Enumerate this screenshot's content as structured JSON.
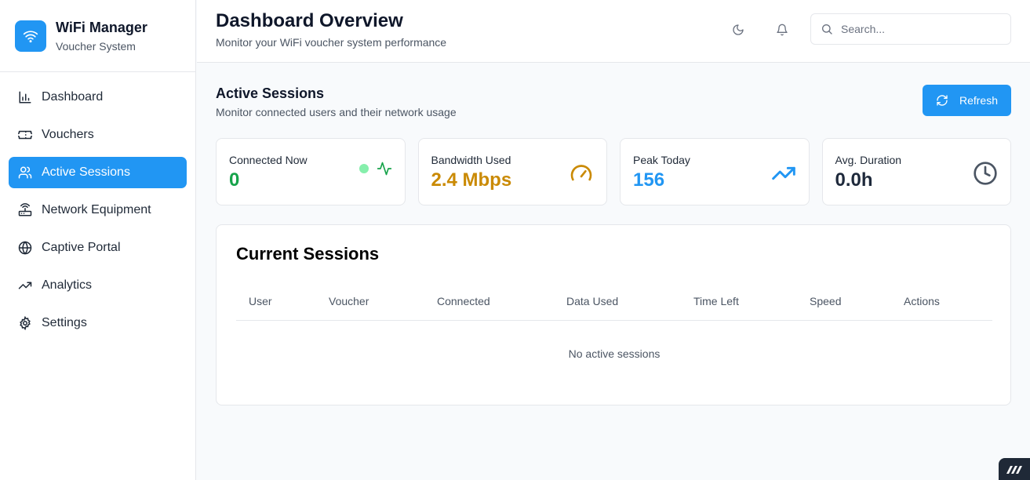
{
  "brand": {
    "title": "WiFi Manager",
    "subtitle": "Voucher System"
  },
  "sidebar": {
    "items": [
      {
        "label": "Dashboard",
        "icon": "bar-chart-icon",
        "active": false
      },
      {
        "label": "Vouchers",
        "icon": "ticket-icon",
        "active": false
      },
      {
        "label": "Active Sessions",
        "icon": "users-icon",
        "active": true
      },
      {
        "label": "Network Equipment",
        "icon": "router-icon",
        "active": false
      },
      {
        "label": "Captive Portal",
        "icon": "globe-icon",
        "active": false
      },
      {
        "label": "Analytics",
        "icon": "trending-up-icon",
        "active": false
      },
      {
        "label": "Settings",
        "icon": "gear-icon",
        "active": false
      }
    ]
  },
  "header": {
    "title": "Dashboard Overview",
    "subtitle": "Monitor your WiFi voucher system performance",
    "search_placeholder": "Search..."
  },
  "section": {
    "title": "Active Sessions",
    "subtitle": "Monitor connected users and their network usage",
    "refresh_label": "Refresh"
  },
  "stats": [
    {
      "label": "Connected Now",
      "value": "0",
      "color": "#16a34a",
      "icon": "activity-icon"
    },
    {
      "label": "Bandwidth Used",
      "value": "2.4 Mbps",
      "color": "#ca8a04",
      "icon": "gauge-icon"
    },
    {
      "label": "Peak Today",
      "value": "156",
      "color": "#2196f3",
      "icon": "trending-up-icon"
    },
    {
      "label": "Avg. Duration",
      "value": "0.0h",
      "color": "#1e293b",
      "icon": "clock-icon"
    }
  ],
  "sessions": {
    "title": "Current Sessions",
    "columns": [
      "User",
      "Voucher",
      "Connected",
      "Data Used",
      "Time Left",
      "Speed",
      "Actions"
    ],
    "empty_text": "No active sessions"
  },
  "colors": {
    "accent": "#2196f3",
    "border": "#e5e7eb",
    "background": "#f8fafc"
  }
}
